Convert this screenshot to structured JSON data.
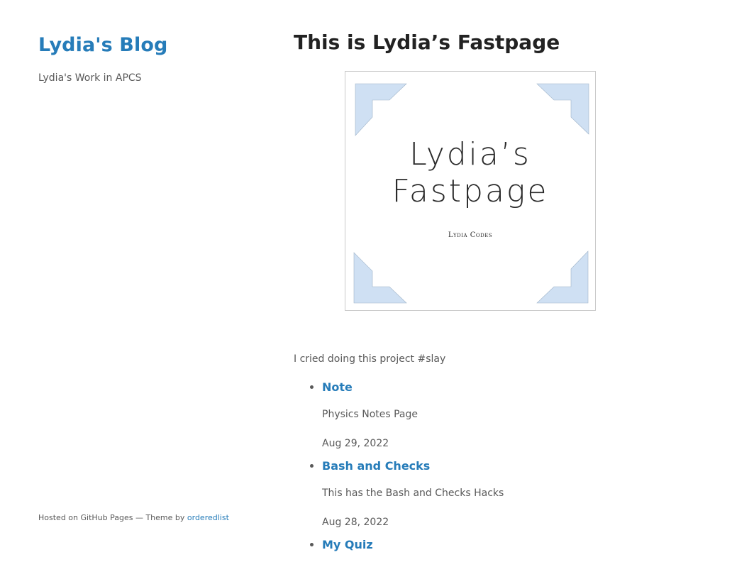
{
  "header": {
    "site_title": "Lydia's Blog",
    "site_description": "Lydia's Work in APCS"
  },
  "footer": {
    "prefix": "Hosted on GitHub Pages — Theme by ",
    "theme_link": "orderedlist"
  },
  "main": {
    "page_title": "This is Lydia’s Fastpage",
    "cover": {
      "line1": "Lydia’s",
      "line2": "Fastpage",
      "subtitle": "Lydia Codes",
      "corner_color": "#cfe0f3"
    },
    "intro": "I cried doing this project #slay",
    "posts": [
      {
        "title": "Note",
        "description": "Physics Notes Page",
        "date": "Aug 29, 2022"
      },
      {
        "title": "Bash and Checks",
        "description": "This has the Bash and Checks Hacks",
        "date": "Aug 28, 2022"
      },
      {
        "title": "My Quiz",
        "description": "",
        "date": ""
      }
    ]
  },
  "colors": {
    "link": "#267CB9",
    "text": "#595959",
    "heading": "#222222"
  }
}
